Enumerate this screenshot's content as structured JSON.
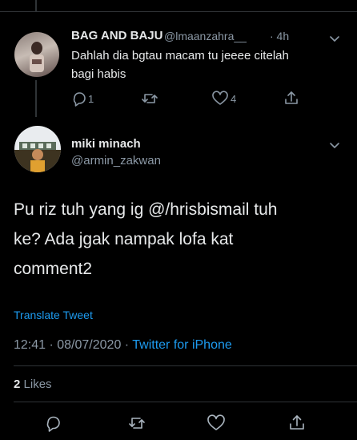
{
  "reply_tweet": {
    "name": "BAG AND BAJU",
    "handle": "@lmaanzahra__",
    "time": "· 4h",
    "text_line1": "Dahlah dia bgtau macam tu jeeee citelah",
    "text_line2": "bagi habis",
    "reply_count": "1",
    "like_count": "4"
  },
  "main_tweet": {
    "name": "miki minach",
    "handle": "@armin_zakwan",
    "text_line1": "Pu riz tuh yang ig @/hrisbismail tuh",
    "text_line2": "ke? Ada jgak nampak lofa kat",
    "text_line3": "comment2",
    "translate": "Translate Tweet",
    "timestamp": "12:41 · 08/07/2020 · ",
    "source": "Twitter for iPhone",
    "likes_count": "2",
    "likes_label": "Likes"
  },
  "colors": {
    "background": "#000000",
    "text": "#e7e9ea",
    "secondary": "#8b98a5",
    "link": "#1d9bf0",
    "divider": "#2f3336"
  }
}
